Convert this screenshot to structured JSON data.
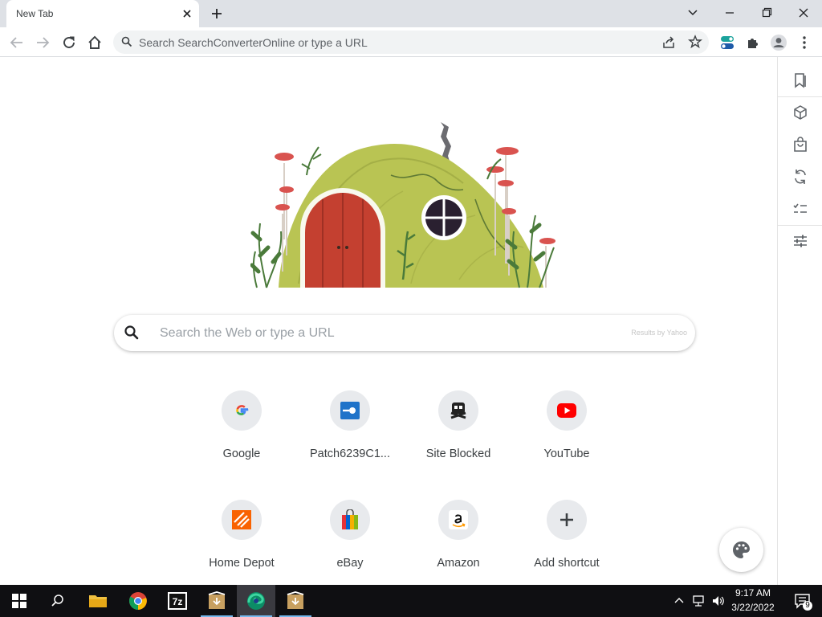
{
  "browser": {
    "tab_title": "New Tab",
    "omnibox_placeholder": "Search SearchConverterOnline or type a URL"
  },
  "search": {
    "placeholder": "Search the Web or type a URL",
    "credit": "Results by Yahoo"
  },
  "shortcuts": [
    {
      "label": "Google",
      "icon": "google-icon"
    },
    {
      "label": "Patch6239C1...",
      "icon": "patch-icon"
    },
    {
      "label": "Site Blocked",
      "icon": "skull-icon"
    },
    {
      "label": "YouTube",
      "icon": "youtube-icon"
    },
    {
      "label": "Home Depot",
      "icon": "home-depot-icon"
    },
    {
      "label": "eBay",
      "icon": "ebay-icon"
    },
    {
      "label": "Amazon",
      "icon": "amazon-icon"
    },
    {
      "label": "Add shortcut",
      "icon": "plus-icon"
    }
  ],
  "side_panel": [
    "bookmark-icon",
    "cube-icon",
    "shopping-bag-icon",
    "refresh-icon",
    "checklist-icon",
    "sliders-icon"
  ],
  "taskbar": {
    "time": "9:17 AM",
    "date": "3/22/2022",
    "notification_count": "9"
  },
  "colors": {
    "accent": "#1a73e8",
    "youtube": "#ff0000",
    "home_depot": "#f96302",
    "taskbar": "#0f0f12"
  }
}
